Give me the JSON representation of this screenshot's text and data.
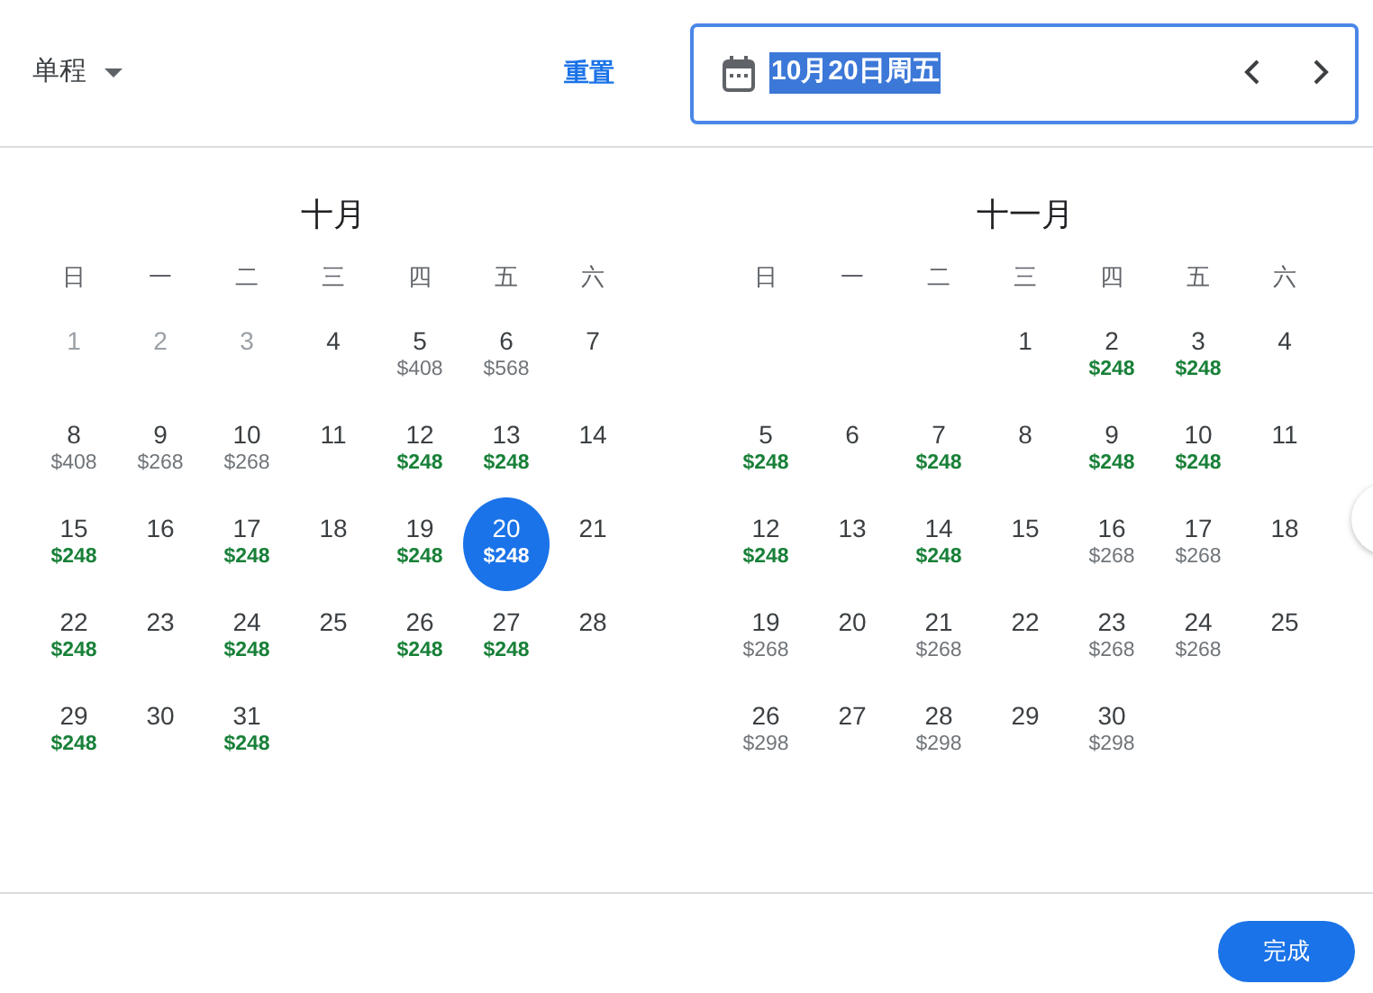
{
  "trip_type": {
    "label": "单程"
  },
  "reset": "重置",
  "date_field": {
    "value": "10月20日周五"
  },
  "months": [
    {
      "title": "十月",
      "weekdays": [
        "日",
        "一",
        "二",
        "三",
        "四",
        "五",
        "六"
      ],
      "days": [
        {
          "kind": "day",
          "date": "1",
          "disabled": true,
          "selected": false
        },
        {
          "kind": "day",
          "date": "2",
          "disabled": true,
          "selected": false
        },
        {
          "kind": "day",
          "date": "3",
          "disabled": true,
          "selected": false
        },
        {
          "kind": "day",
          "date": "4",
          "disabled": false,
          "selected": false
        },
        {
          "kind": "day",
          "date": "5",
          "price": "$408",
          "low": false,
          "disabled": false,
          "selected": false
        },
        {
          "kind": "day",
          "date": "6",
          "price": "$568",
          "low": false,
          "disabled": false,
          "selected": false
        },
        {
          "kind": "day",
          "date": "7",
          "disabled": false,
          "selected": false
        },
        {
          "kind": "day",
          "date": "8",
          "price": "$408",
          "low": false,
          "disabled": false,
          "selected": false
        },
        {
          "kind": "day",
          "date": "9",
          "price": "$268",
          "low": false,
          "disabled": false,
          "selected": false
        },
        {
          "kind": "day",
          "date": "10",
          "price": "$268",
          "low": false,
          "disabled": false,
          "selected": false
        },
        {
          "kind": "day",
          "date": "11",
          "disabled": false,
          "selected": false
        },
        {
          "kind": "day",
          "date": "12",
          "price": "$248",
          "low": true,
          "disabled": false,
          "selected": false
        },
        {
          "kind": "day",
          "date": "13",
          "price": "$248",
          "low": true,
          "disabled": false,
          "selected": false
        },
        {
          "kind": "day",
          "date": "14",
          "disabled": false,
          "selected": false
        },
        {
          "kind": "day",
          "date": "15",
          "price": "$248",
          "low": true,
          "disabled": false,
          "selected": false
        },
        {
          "kind": "day",
          "date": "16",
          "disabled": false,
          "selected": false
        },
        {
          "kind": "day",
          "date": "17",
          "price": "$248",
          "low": true,
          "disabled": false,
          "selected": false
        },
        {
          "kind": "day",
          "date": "18",
          "disabled": false,
          "selected": false
        },
        {
          "kind": "day",
          "date": "19",
          "price": "$248",
          "low": true,
          "disabled": false,
          "selected": false
        },
        {
          "kind": "day",
          "date": "20",
          "price": "$248",
          "low": true,
          "disabled": false,
          "selected": true
        },
        {
          "kind": "day",
          "date": "21",
          "disabled": false,
          "selected": false
        },
        {
          "kind": "day",
          "date": "22",
          "price": "$248",
          "low": true,
          "disabled": false,
          "selected": false
        },
        {
          "kind": "day",
          "date": "23",
          "disabled": false,
          "selected": false
        },
        {
          "kind": "day",
          "date": "24",
          "price": "$248",
          "low": true,
          "disabled": false,
          "selected": false
        },
        {
          "kind": "day",
          "date": "25",
          "disabled": false,
          "selected": false
        },
        {
          "kind": "day",
          "date": "26",
          "price": "$248",
          "low": true,
          "disabled": false,
          "selected": false
        },
        {
          "kind": "day",
          "date": "27",
          "price": "$248",
          "low": true,
          "disabled": false,
          "selected": false
        },
        {
          "kind": "day",
          "date": "28",
          "disabled": false,
          "selected": false
        },
        {
          "kind": "day",
          "date": "29",
          "price": "$248",
          "low": true,
          "disabled": false,
          "selected": false
        },
        {
          "kind": "day",
          "date": "30",
          "disabled": false,
          "selected": false
        },
        {
          "kind": "day",
          "date": "31",
          "price": "$248",
          "low": true,
          "disabled": false,
          "selected": false
        }
      ]
    },
    {
      "title": "十一月",
      "weekdays": [
        "日",
        "一",
        "二",
        "三",
        "四",
        "五",
        "六"
      ],
      "days": [
        {
          "kind": "blank"
        },
        {
          "kind": "blank"
        },
        {
          "kind": "blank"
        },
        {
          "kind": "day",
          "date": "1",
          "disabled": false,
          "selected": false
        },
        {
          "kind": "day",
          "date": "2",
          "price": "$248",
          "low": true,
          "disabled": false,
          "selected": false
        },
        {
          "kind": "day",
          "date": "3",
          "price": "$248",
          "low": true,
          "disabled": false,
          "selected": false
        },
        {
          "kind": "day",
          "date": "4",
          "disabled": false,
          "selected": false
        },
        {
          "kind": "day",
          "date": "5",
          "price": "$248",
          "low": true,
          "disabled": false,
          "selected": false
        },
        {
          "kind": "day",
          "date": "6",
          "disabled": false,
          "selected": false
        },
        {
          "kind": "day",
          "date": "7",
          "price": "$248",
          "low": true,
          "disabled": false,
          "selected": false
        },
        {
          "kind": "day",
          "date": "8",
          "disabled": false,
          "selected": false
        },
        {
          "kind": "day",
          "date": "9",
          "price": "$248",
          "low": true,
          "disabled": false,
          "selected": false
        },
        {
          "kind": "day",
          "date": "10",
          "price": "$248",
          "low": true,
          "disabled": false,
          "selected": false
        },
        {
          "kind": "day",
          "date": "11",
          "disabled": false,
          "selected": false
        },
        {
          "kind": "day",
          "date": "12",
          "price": "$248",
          "low": true,
          "disabled": false,
          "selected": false
        },
        {
          "kind": "day",
          "date": "13",
          "disabled": false,
          "selected": false
        },
        {
          "kind": "day",
          "date": "14",
          "price": "$248",
          "low": true,
          "disabled": false,
          "selected": false
        },
        {
          "kind": "day",
          "date": "15",
          "disabled": false,
          "selected": false
        },
        {
          "kind": "day",
          "date": "16",
          "price": "$268",
          "low": false,
          "disabled": false,
          "selected": false
        },
        {
          "kind": "day",
          "date": "17",
          "price": "$268",
          "low": false,
          "disabled": false,
          "selected": false
        },
        {
          "kind": "day",
          "date": "18",
          "disabled": false,
          "selected": false
        },
        {
          "kind": "day",
          "date": "19",
          "price": "$268",
          "low": false,
          "disabled": false,
          "selected": false
        },
        {
          "kind": "day",
          "date": "20",
          "disabled": false,
          "selected": false
        },
        {
          "kind": "day",
          "date": "21",
          "price": "$268",
          "low": false,
          "disabled": false,
          "selected": false
        },
        {
          "kind": "day",
          "date": "22",
          "disabled": false,
          "selected": false
        },
        {
          "kind": "day",
          "date": "23",
          "price": "$268",
          "low": false,
          "disabled": false,
          "selected": false
        },
        {
          "kind": "day",
          "date": "24",
          "price": "$268",
          "low": false,
          "disabled": false,
          "selected": false
        },
        {
          "kind": "day",
          "date": "25",
          "disabled": false,
          "selected": false
        },
        {
          "kind": "day",
          "date": "26",
          "price": "$298",
          "low": false,
          "disabled": false,
          "selected": false
        },
        {
          "kind": "day",
          "date": "27",
          "disabled": false,
          "selected": false
        },
        {
          "kind": "day",
          "date": "28",
          "price": "$298",
          "low": false,
          "disabled": false,
          "selected": false
        },
        {
          "kind": "day",
          "date": "29",
          "disabled": false,
          "selected": false
        },
        {
          "kind": "day",
          "date": "30",
          "price": "$298",
          "low": false,
          "disabled": false,
          "selected": false
        }
      ]
    }
  ],
  "done_button": "完成"
}
